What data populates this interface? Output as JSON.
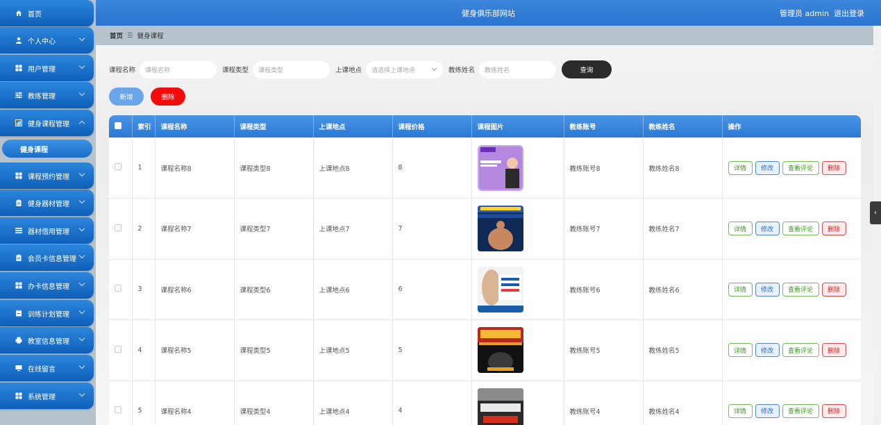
{
  "header": {
    "title": "健身俱乐部网站",
    "admin_label": "管理员 admin",
    "logout": "退出登录"
  },
  "sidebar": {
    "items": [
      {
        "label": "首页",
        "icon": "home-icon",
        "has_arrow": false
      },
      {
        "label": "个人中心",
        "icon": "user-icon",
        "has_arrow": true
      },
      {
        "label": "用户管理",
        "icon": "grid-icon",
        "has_arrow": true
      },
      {
        "label": "教练管理",
        "icon": "sliders-icon",
        "has_arrow": true
      },
      {
        "label": "健身课程管理",
        "icon": "chart-icon",
        "has_arrow": true,
        "expanded": true
      },
      {
        "label": "课程预约管理",
        "icon": "grid-icon",
        "has_arrow": true
      },
      {
        "label": "健身器材管理",
        "icon": "clipboard-icon",
        "has_arrow": true
      },
      {
        "label": "器材借用管理",
        "icon": "list-icon",
        "has_arrow": true
      },
      {
        "label": "会员卡信息管理",
        "icon": "clipboard-icon",
        "has_arrow": true
      },
      {
        "label": "办卡信息管理",
        "icon": "grid-icon",
        "has_arrow": true
      },
      {
        "label": "训练计划管理",
        "icon": "calendar-icon",
        "has_arrow": true
      },
      {
        "label": "教室信息管理",
        "icon": "print-icon",
        "has_arrow": true
      },
      {
        "label": "在线留言",
        "icon": "monitor-icon",
        "has_arrow": true
      },
      {
        "label": "系统管理",
        "icon": "grid-icon",
        "has_arrow": true
      }
    ],
    "active_sub": "健身课程"
  },
  "breadcrumb": {
    "home": "首页",
    "separator": "☰",
    "current": "健身课程"
  },
  "search": {
    "fields": [
      {
        "label": "课程名称",
        "placeholder": "课程名称"
      },
      {
        "label": "课程类型",
        "placeholder": "课程类型"
      },
      {
        "label": "上课地点",
        "placeholder": "请选择上课地点",
        "select": true
      },
      {
        "label": "教练姓名",
        "placeholder": "教练姓名"
      }
    ],
    "button": "查询"
  },
  "actions": {
    "add": "新增",
    "delete": "删除"
  },
  "table": {
    "headers": [
      "索引",
      "课程名称",
      "课程类型",
      "上课地点",
      "课程价格",
      "课程图片",
      "教练账号",
      "教练姓名",
      "操作"
    ],
    "rows": [
      {
        "index": "1",
        "name": "课程名称8",
        "type": "课程类型8",
        "place": "上课地点8",
        "price": "8",
        "coach_account": "教练账号8",
        "coach_name": "教练姓名8",
        "thumb": {
          "bg": "#b88be0",
          "text": "SPAY",
          "sub": "10节精品课"
        }
      },
      {
        "index": "2",
        "name": "课程名称7",
        "type": "课程类型7",
        "place": "上课地点7",
        "price": "7",
        "coach_account": "教练账号7",
        "coach_name": "教练姓名7",
        "thumb": {
          "bg": "#1d3f7a",
          "text": "",
          "sub": ""
        }
      },
      {
        "index": "3",
        "name": "课程名称6",
        "type": "课程类型6",
        "place": "上课地点6",
        "price": "6",
        "coach_account": "教练账号6",
        "coach_name": "教练姓名6",
        "thumb": {
          "bg": "#e8eef5",
          "text": "全套健身",
          "sub": "专业课程"
        }
      },
      {
        "index": "4",
        "name": "课程名称5",
        "type": "课程类型5",
        "place": "上课地点5",
        "price": "5",
        "coach_account": "教练账号5",
        "coach_name": "教练姓名5",
        "thumb": {
          "bg": "#1a1a1a",
          "text": "健身教学",
          "sub": ""
        }
      },
      {
        "index": "5",
        "name": "课程名称4",
        "type": "课程类型4",
        "place": "上课地点4",
        "price": "4",
        "coach_account": "教练账号4",
        "coach_name": "教练姓名4",
        "thumb": {
          "bg": "#3a3a3a",
          "text": "小团体课程",
          "sub": ""
        }
      }
    ],
    "ops": {
      "detail": "详情",
      "edit": "修改",
      "review": "查看评论",
      "remove": "删除"
    }
  },
  "colors": {
    "primary": "#2a73cf",
    "danger": "#f20c0c",
    "dark": "#2b2b2b"
  }
}
